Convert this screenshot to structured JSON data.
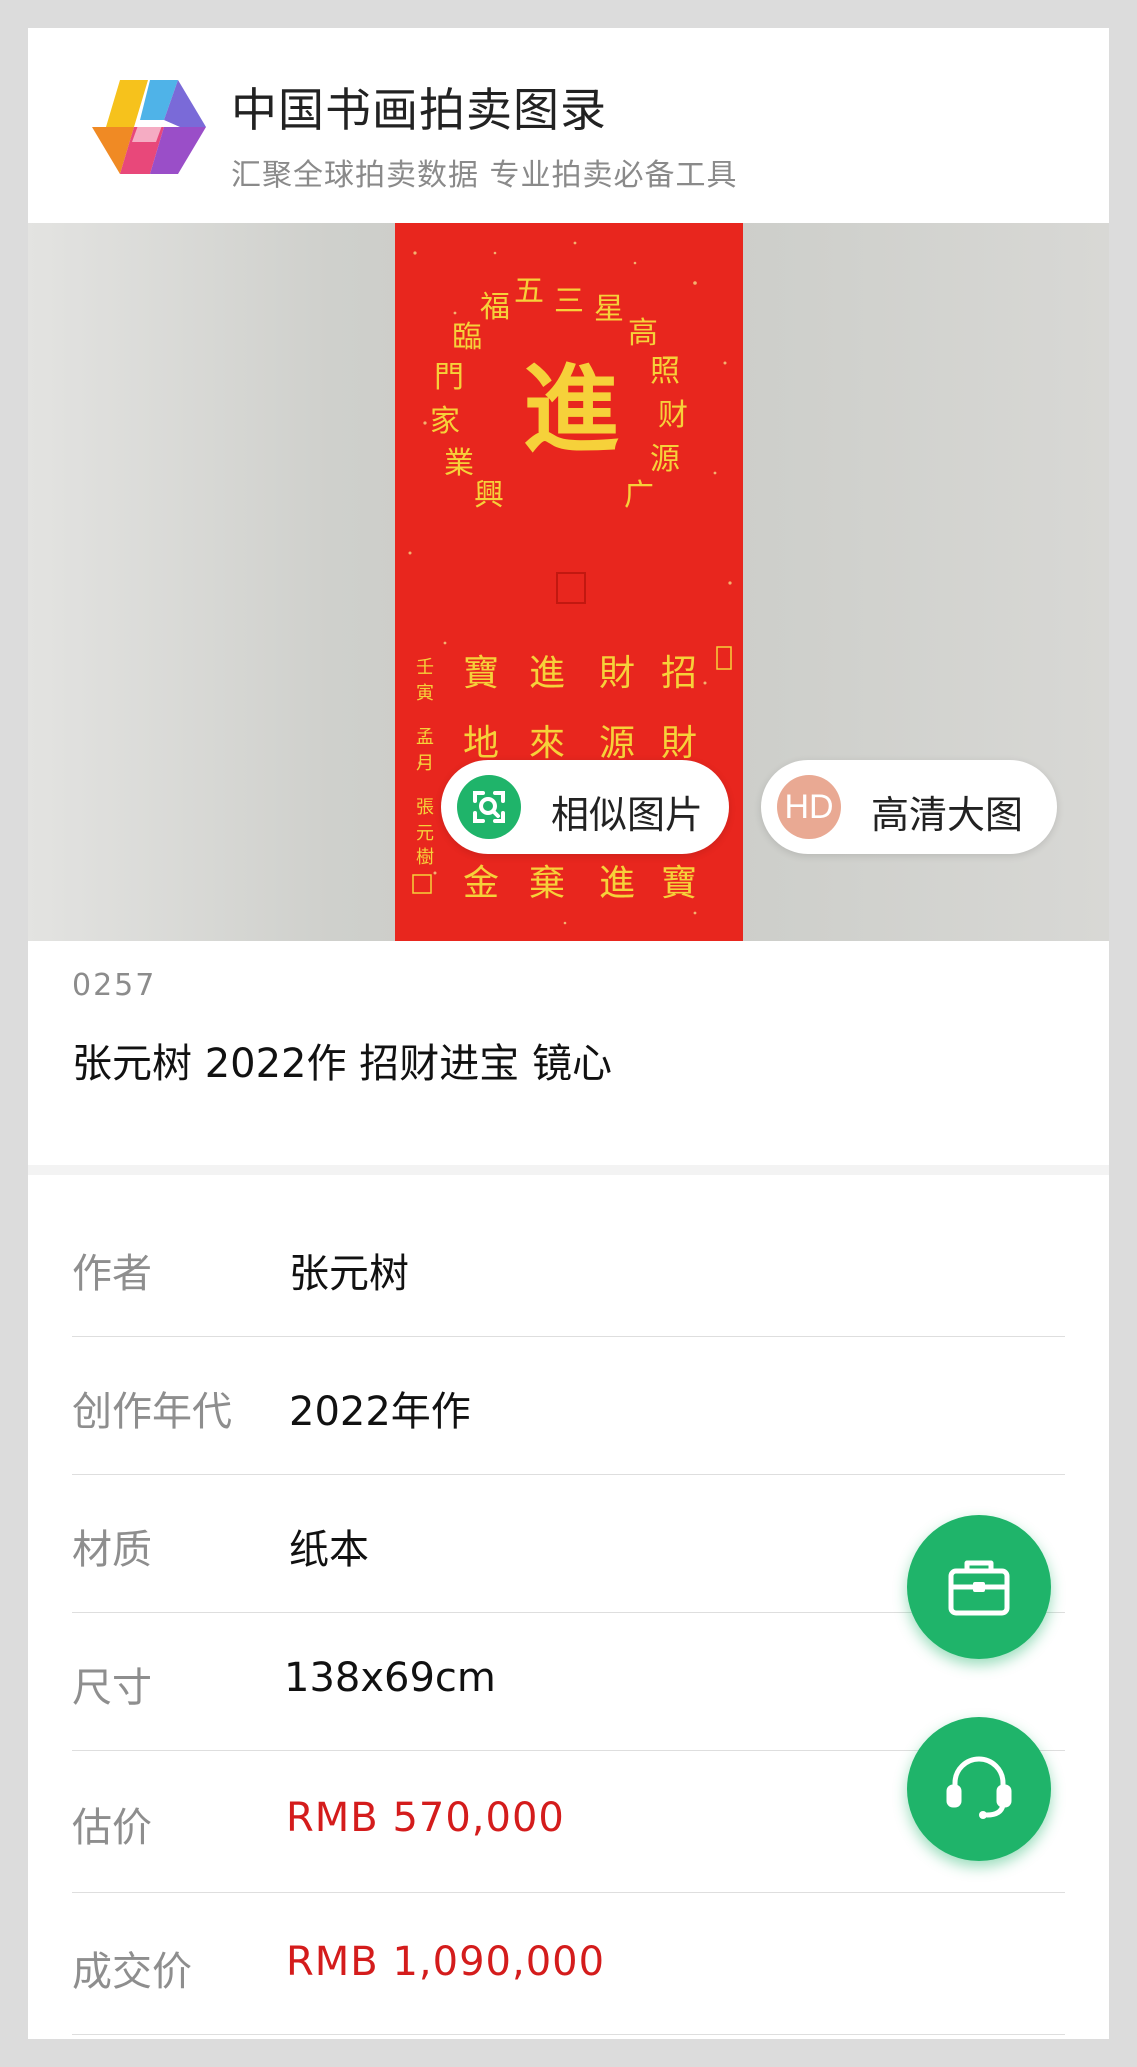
{
  "header": {
    "title": "中国书画拍卖图录",
    "subtitle": "汇聚全球拍卖数据 专业拍卖必备工具",
    "logo_icon": "hexagon-logo-icon"
  },
  "image_actions": {
    "similar_label": "相似图片",
    "similar_icon": "scan-icon",
    "hd_label": "高清大图",
    "hd_badge": "HD"
  },
  "lot": {
    "number": "0257",
    "title": "张元树 2022作 招财进宝 镜心"
  },
  "details": [
    {
      "label": "作者",
      "value": "张元树"
    },
    {
      "label": "创作年代",
      "value": "2022年作"
    },
    {
      "label": "材质",
      "value": "纸本"
    },
    {
      "label": "尺寸",
      "value": "138x69cm"
    },
    {
      "label": "估价",
      "value": "RMB 570,000"
    },
    {
      "label": "成交价",
      "value": "RMB 1,090,000"
    }
  ],
  "fabs": {
    "briefcase_icon": "briefcase-icon",
    "support_icon": "headset-icon"
  },
  "colors": {
    "accent_green": "#1fb46a",
    "price_red": "#d41c1c",
    "artwork_red": "#e8261e",
    "gold": "#f4d03f"
  }
}
